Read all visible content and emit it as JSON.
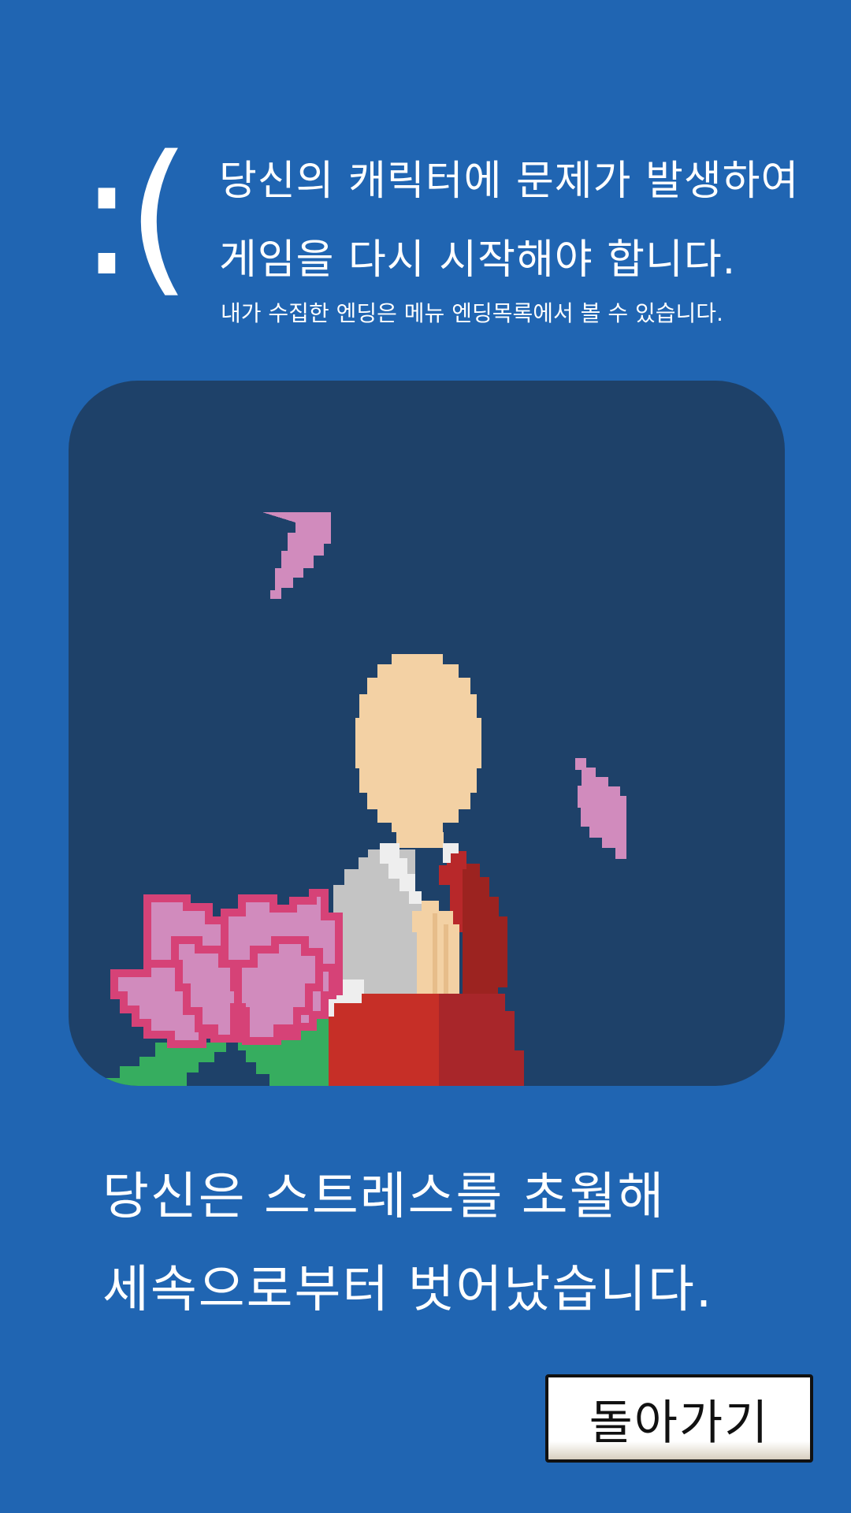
{
  "error_screen": {
    "face": ":(",
    "message_line1": "당신의 캐릭터에 문제가 발생하여",
    "message_line2": "게임을 다시 시작해야 합니다.",
    "sub_message": "내가 수집한 엔딩은 메뉴 엔딩목록에서 볼 수 있습니다."
  },
  "scene": {
    "description_icons": [
      "monk-figure",
      "lotus-flower",
      "falling-petal"
    ],
    "colors": {
      "background": "#1e4169",
      "skin": "#f3d1a4",
      "robe_gray": "#c4c4c4",
      "robe_red": "#c62f27",
      "lotus_pink": "#d18bbd",
      "lotus_outline": "#d64277",
      "leaf_green": "#36ad5f"
    }
  },
  "ending": {
    "line1": "당신은 스트레스를 초월해",
    "line2": "세속으로부터 벗어났습니다."
  },
  "back_button_label": "돌아가기",
  "colors": {
    "page_background": "#2065b2",
    "text": "#ffffff"
  }
}
